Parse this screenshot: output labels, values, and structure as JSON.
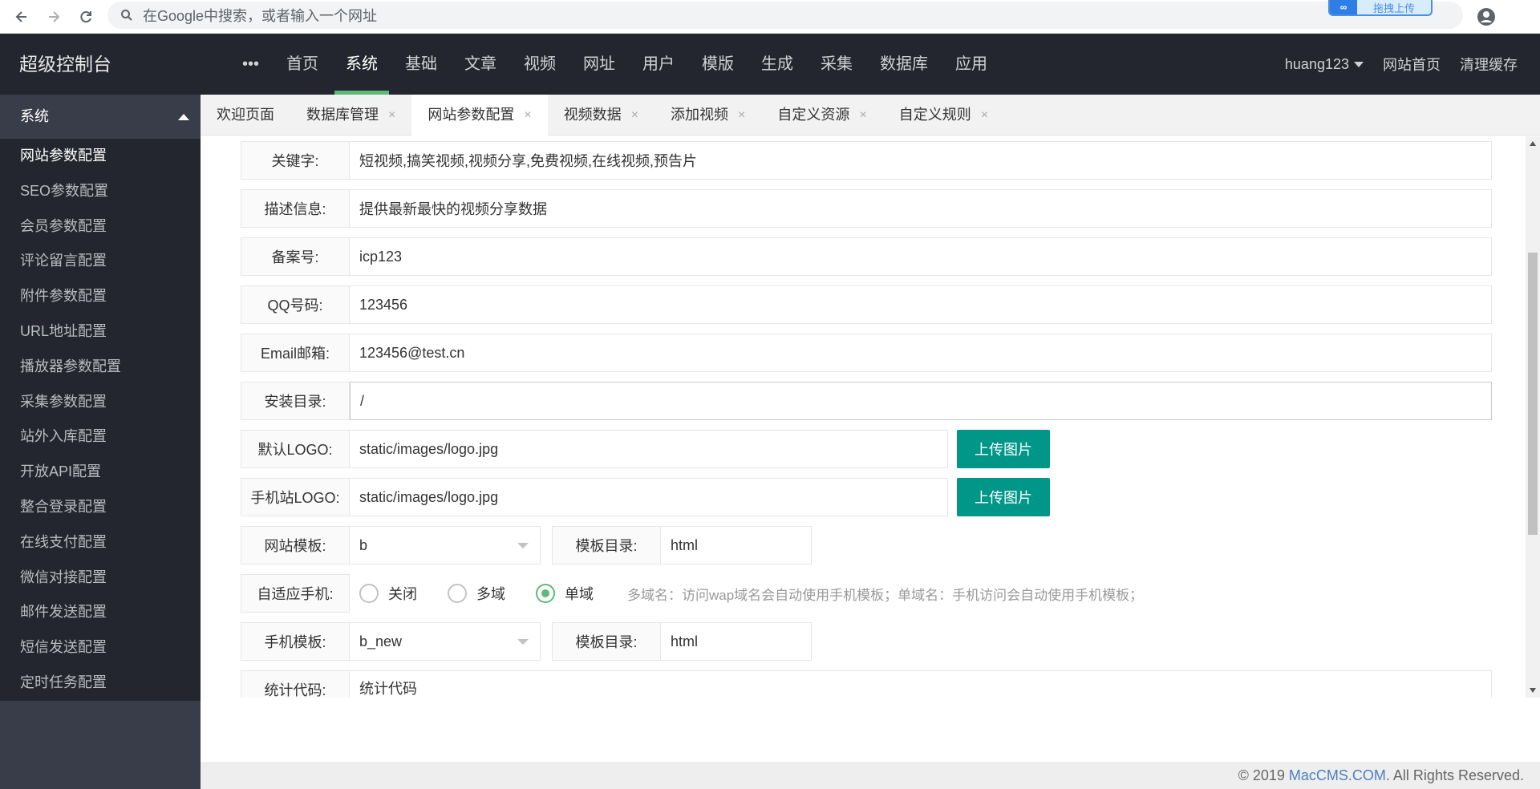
{
  "browser": {
    "address_placeholder": "在Google中搜索，或者输入一个网址",
    "extension_label": "拖拽上传"
  },
  "header": {
    "brand": "超级控制台",
    "more_label": "•••",
    "nav": [
      "首页",
      "系统",
      "基础",
      "文章",
      "视频",
      "网址",
      "用户",
      "模版",
      "生成",
      "采集",
      "数据库",
      "应用"
    ],
    "active_nav": "系统",
    "user": "huang123",
    "site_home": "网站首页",
    "clear_cache": "清理缓存"
  },
  "sidebar": {
    "section": "系统",
    "items": [
      "网站参数配置",
      "SEO参数配置",
      "会员参数配置",
      "评论留言配置",
      "附件参数配置",
      "URL地址配置",
      "播放器参数配置",
      "采集参数配置",
      "站外入库配置",
      "开放API配置",
      "整合登录配置",
      "在线支付配置",
      "微信对接配置",
      "邮件发送配置",
      "短信发送配置",
      "定时任务配置"
    ],
    "active": "网站参数配置"
  },
  "tabs": [
    {
      "label": "欢迎页面",
      "closable": false
    },
    {
      "label": "数据库管理",
      "closable": true
    },
    {
      "label": "网站参数配置",
      "closable": true,
      "active": true
    },
    {
      "label": "视频数据",
      "closable": true
    },
    {
      "label": "添加视频",
      "closable": true
    },
    {
      "label": "自定义资源",
      "closable": true
    },
    {
      "label": "自定义规则",
      "closable": true
    }
  ],
  "tab_close_glyph": "×",
  "form": {
    "keywords": {
      "label": "关键字:",
      "value": "短视频,搞笑视频,视频分享,免费视频,在线视频,预告片"
    },
    "description": {
      "label": "描述信息:",
      "value": "提供最新最快的视频分享数据"
    },
    "icp": {
      "label": "备案号:",
      "value": "icp123"
    },
    "qq": {
      "label": "QQ号码:",
      "value": "123456"
    },
    "email": {
      "label": "Email邮箱:",
      "value": "123456@test.cn"
    },
    "install_dir": {
      "label": "安装目录:",
      "value": "/"
    },
    "logo": {
      "label": "默认LOGO:",
      "value": "static/images/logo.jpg",
      "button": "上传图片"
    },
    "mobile_logo": {
      "label": "手机站LOGO:",
      "value": "static/images/logo.jpg",
      "button": "上传图片"
    },
    "template": {
      "label": "网站模板:",
      "value": "b",
      "dir_label": "模板目录:",
      "dir_value": "html"
    },
    "adaptive": {
      "label": "自适应手机:",
      "options": [
        "关闭",
        "多域",
        "单域"
      ],
      "selected": "单域",
      "hint": "多域名：访问wap域名会自动使用手机模板；单域名：手机访问会自动使用手机模板；"
    },
    "mobile_template": {
      "label": "手机模板:",
      "value": "b_new",
      "dir_label": "模板目录:",
      "dir_value": "html"
    },
    "stats_code": {
      "label": "统计代码:",
      "value": "统计代码"
    }
  },
  "footer": {
    "prefix": "© 2019 ",
    "link": "MacCMS.COM",
    "suffix": ". All Rights Reserved."
  },
  "colors": {
    "header_bg": "#23262e",
    "accent_green": "#5fb878",
    "button_teal": "#009688"
  }
}
